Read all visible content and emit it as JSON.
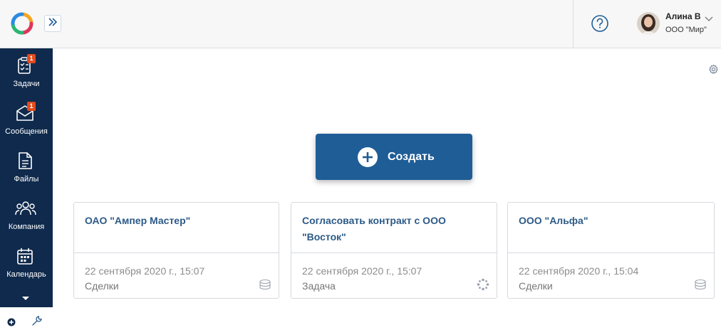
{
  "header": {
    "logo": "app-logo",
    "expand_icon": "double-chevron-right-icon",
    "help_icon": "question-circle-icon",
    "user": {
      "name": "Алина В",
      "company": "ООО \"Мир\""
    }
  },
  "sidebar": {
    "items": [
      {
        "label": "Задачи",
        "icon": "tasks-clipboard-icon",
        "badge": "1"
      },
      {
        "label": "Сообщения",
        "icon": "messages-envelope-icon",
        "badge": "1"
      },
      {
        "label": "Файлы",
        "icon": "file-icon",
        "badge": ""
      },
      {
        "label": "Компания",
        "icon": "people-icon",
        "badge": ""
      },
      {
        "label": "Календарь",
        "icon": "calendar-icon",
        "badge": ""
      }
    ],
    "more_icon": "triangle-down-icon",
    "bottom": {
      "add_icon": "plus-circle-icon",
      "settings_icon": "wrench-icon"
    }
  },
  "main": {
    "create_button": {
      "label": "Создать",
      "icon": "plus-circle-icon"
    },
    "cards": [
      {
        "title": "ОАО \"Ампер Мастер\"",
        "date": "22 сентября 2020 г., 15:07",
        "type": "Сделки",
        "icon": "coins-stack-icon"
      },
      {
        "title": "Согласовать контракт с ООО \"Восток\"",
        "date": "22 сентября 2020 г., 15:07",
        "type": "Задача",
        "icon": "process-spinner-icon"
      },
      {
        "title": "ООО \"Альфа\"",
        "date": "22 сентября 2020 г., 15:04",
        "type": "Сделки",
        "icon": "coins-stack-icon"
      }
    ]
  },
  "colors": {
    "sidebar_bg": "#0f2a4c",
    "accent": "#1f5d96",
    "card_title": "#2c5a87",
    "badge": "#e04b1f"
  }
}
